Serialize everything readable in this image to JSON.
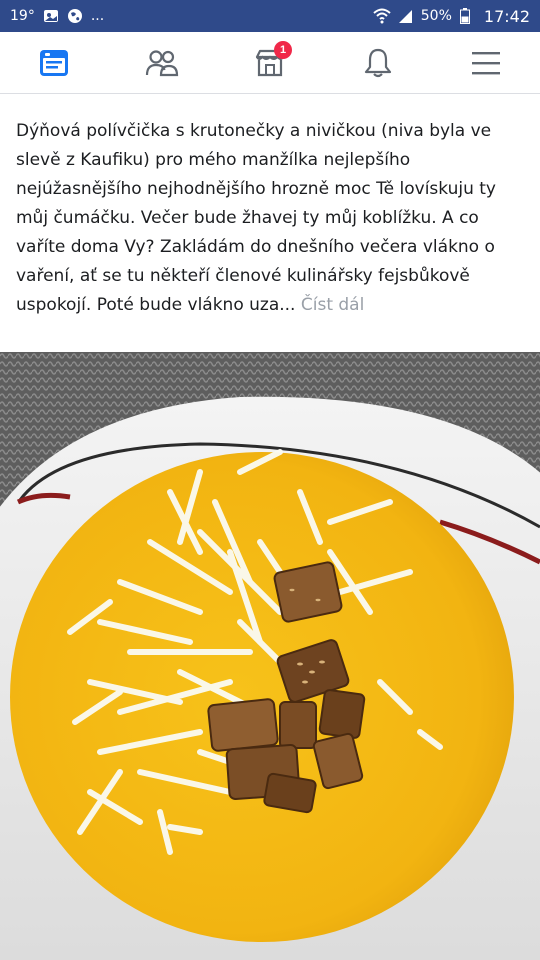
{
  "status_bar": {
    "temperature": "19°",
    "ellipsis": "...",
    "battery": "50%",
    "time": "17:42"
  },
  "nav": {
    "items": [
      {
        "name": "news-feed",
        "icon": "news-feed-icon",
        "active": true
      },
      {
        "name": "groups",
        "icon": "friends-icon"
      },
      {
        "name": "marketplace",
        "icon": "marketplace-icon",
        "badge": "1"
      },
      {
        "name": "notifications",
        "icon": "bell-icon"
      },
      {
        "name": "menu",
        "icon": "hamburger-icon"
      }
    ],
    "active_color": "#1877f2",
    "icon_color": "#606770"
  },
  "post": {
    "text": "Dýňová polívčička s krutonečky a nivičkou (niva byla ve slevě z Kaufiku) pro mého manžílka nejlepšího nejúžasnějšího nejhodnějšího hrozně moc Tě lovískuju ty můj čumáčku. Večer bude žhavej ty můj koblížku. A co vaříte doma Vy? Zakládám do dnešního večera vlákno o vaření, ať se tu někteří členové kulinářsky fejsbůkově uspokojí. Poté bude vlákno uza...",
    "read_more": "Číst dál"
  },
  "photo": {
    "subject": "pumpkin-soup-photo"
  }
}
